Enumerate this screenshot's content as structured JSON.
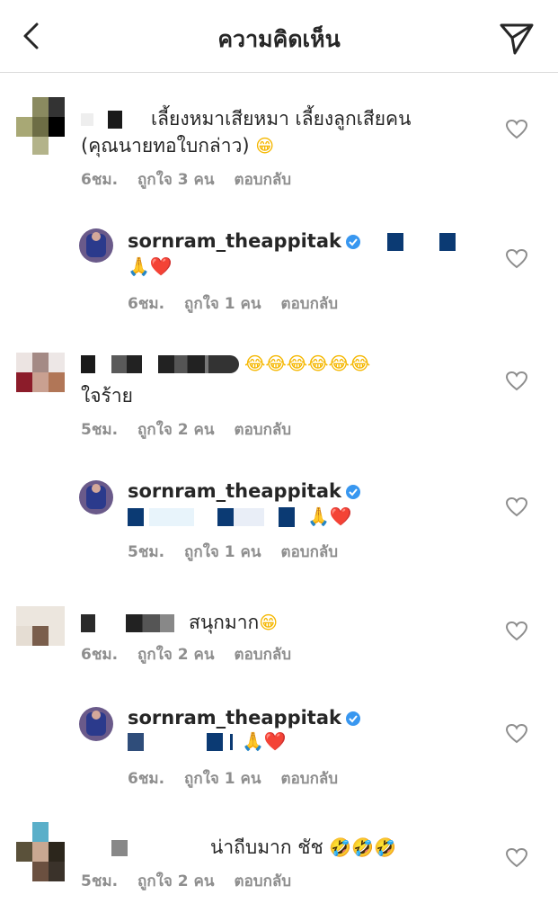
{
  "header": {
    "title": "ความคิดเห็น"
  },
  "comments": [
    {
      "text_line1": "เลี้ยงหมาเสียหมา เลี้ยงลูกเสียคน",
      "text_line2": "(คุณนายทอใบกล่าว)",
      "emoji": "😁",
      "time": "6ชม.",
      "likes": "ถูกใจ 3 คน",
      "reply": "ตอบกลับ"
    },
    {
      "username": "sornram_theappitak",
      "verified": true,
      "emoji": "🙏❤️",
      "time": "6ชม.",
      "likes": "ถูกใจ 1 คน",
      "reply": "ตอบกลับ"
    },
    {
      "emoji": "😂😂😂😂😂😂",
      "text_line2": "ใจร้าย",
      "time": "5ชม.",
      "likes": "ถูกใจ 2 คน",
      "reply": "ตอบกลับ"
    },
    {
      "username": "sornram_theappitak",
      "verified": true,
      "emoji": "🙏❤️",
      "time": "5ชม.",
      "likes": "ถูกใจ 1 คน",
      "reply": "ตอบกลับ"
    },
    {
      "text_line1": "สนุกมาก",
      "emoji": "😁",
      "time": "6ชม.",
      "likes": "ถูกใจ 2 คน",
      "reply": "ตอบกลับ"
    },
    {
      "username": "sornram_theappitak",
      "verified": true,
      "emoji": "🙏❤️",
      "time": "6ชม.",
      "likes": "ถูกใจ 1 คน",
      "reply": "ตอบกลับ"
    },
    {
      "text_line1": "น่าถีบมาก ชัช",
      "emoji": "🤣🤣🤣",
      "time": "5ชม.",
      "likes": "ถูกใจ 2 คน",
      "reply": "ตอบกลับ"
    }
  ],
  "icons": {
    "back": "chevron-left-icon",
    "send": "paper-plane-icon",
    "like": "heart-outline-icon",
    "verified": "verified-badge-icon"
  },
  "colors": {
    "verified": "#3897f0",
    "muted": "#8e8e8e",
    "text": "#262626",
    "redaction": "#0b3a73"
  }
}
